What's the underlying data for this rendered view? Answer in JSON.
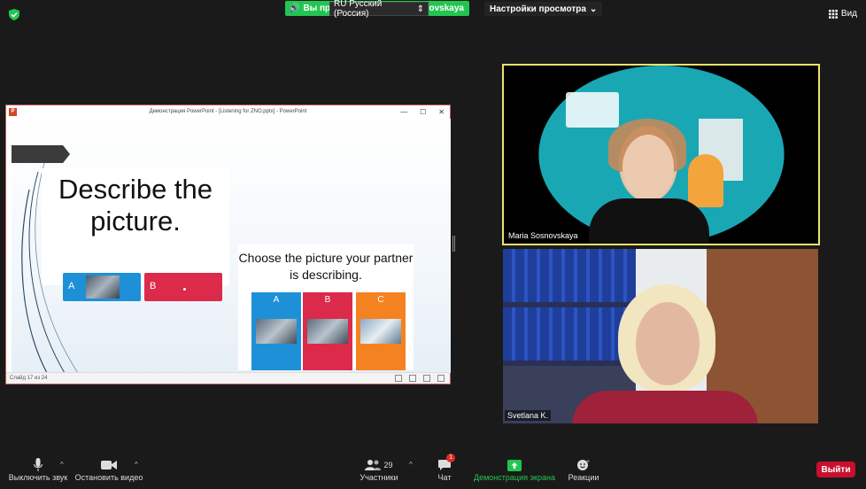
{
  "topbar": {
    "speaking_label": "Вы прос",
    "speaking_tail": "osnovskaya",
    "language": "RU Русский (Россия)",
    "view_options": "Настройки просмотра",
    "view_label": "Вид"
  },
  "ppt": {
    "window_title": "Демонстрация PowerPoint - [Listening for ZNO.pptx] - PowerPoint",
    "status_text": "Слайд 17 из 24",
    "slide": {
      "heading": "Describe the picture.",
      "option_a": "A",
      "option_b": "B",
      "subheading": "Choose the picture your partner is describing.",
      "cards": [
        "A",
        "B",
        "C"
      ]
    }
  },
  "videos": [
    {
      "name": "Maria Sosnovskaya"
    },
    {
      "name": "Svetlana K."
    }
  ],
  "toolbar": {
    "mute": "Выключить звук",
    "stop_video": "Остановить видео",
    "participants": "Участники",
    "participants_count": "29",
    "chat": "Чат",
    "chat_badge": "1",
    "share": "Демонстрация экрана",
    "reactions": "Реакции",
    "leave": "Выйти"
  },
  "colors": {
    "speaking_green": "#23c552",
    "share_green": "#23c552",
    "leave_red": "#c8102e",
    "active_border": "#f0e36a"
  }
}
